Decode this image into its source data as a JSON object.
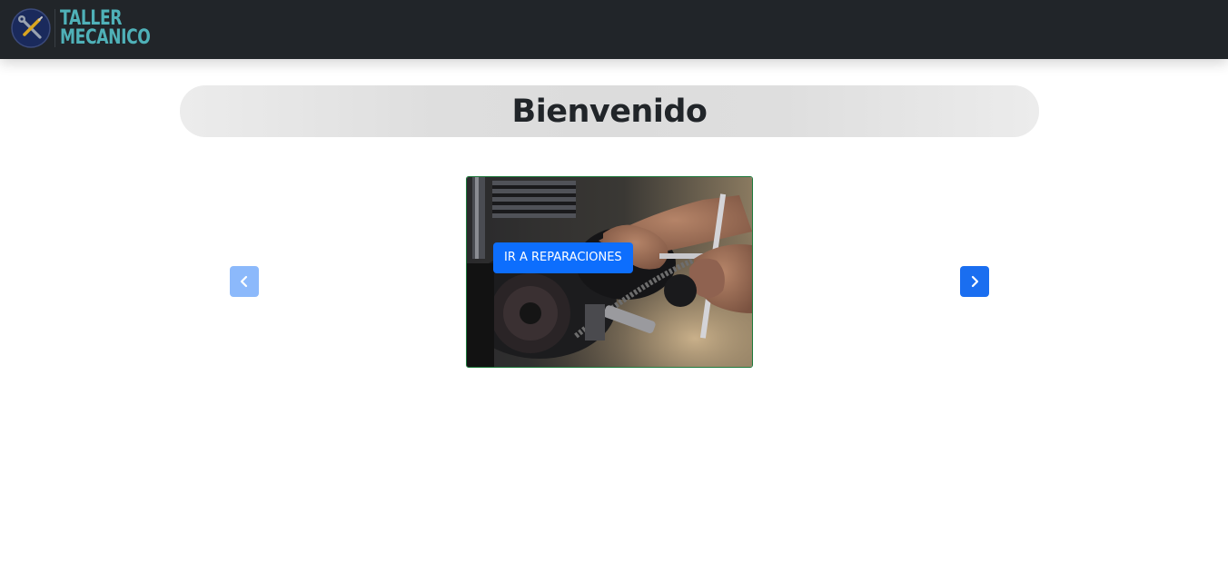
{
  "navbar": {
    "brand": {
      "line1": "TALLER",
      "line2": "MECANICO",
      "icon": "wrench-screwdriver-icon",
      "color": "#4fb1b8"
    },
    "background": "#212529"
  },
  "main": {
    "welcome_title": "Bienvenido"
  },
  "carousel": {
    "prev_icon": "chevron-left-icon",
    "next_icon": "chevron-right-icon",
    "slide": {
      "image": "motorcycle-repair-photo",
      "button_label": "IR A REPARACIONES",
      "button_color": "#0d6efd"
    }
  }
}
